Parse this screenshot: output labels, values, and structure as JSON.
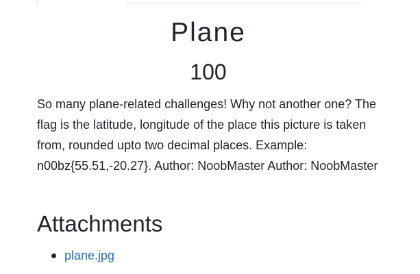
{
  "challenge": {
    "name": "Plane",
    "value": "100",
    "description": "So many plane-related challenges! Why not another one? The flag is the latitude, longitude of the place this picture is taken from, rounded upto two decimal places. Example: n00bz{55.51,-20.27}. Author: NoobMaster Author: NoobMaster"
  },
  "attachments": {
    "heading": "Attachments",
    "files": [
      {
        "name": "plane.jpg"
      }
    ]
  },
  "colors": {
    "link": "#2470b8",
    "text": "#212529",
    "border": "#dee2e6"
  }
}
